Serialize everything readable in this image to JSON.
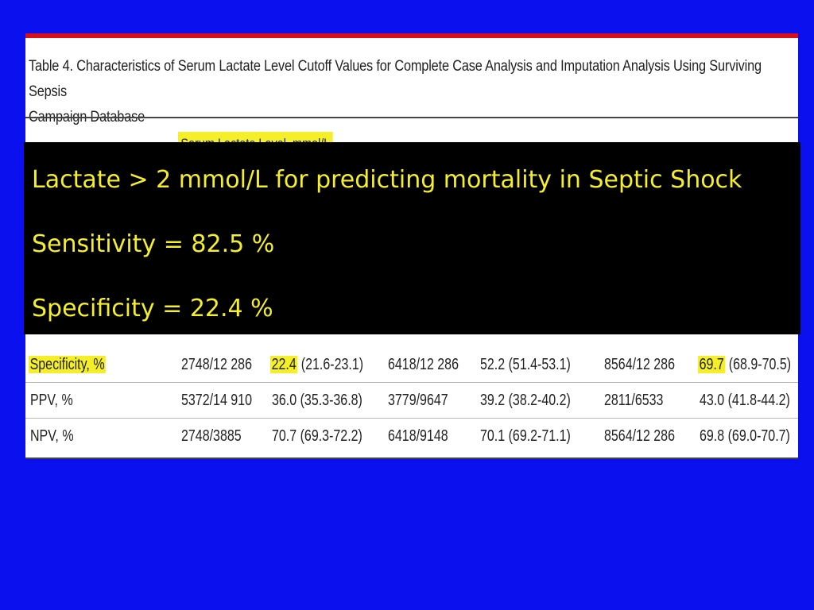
{
  "table": {
    "title_line1": "Table 4. Characteristics of Serum Lactate Level Cutoff Values for Complete Case Analysis and Imputation Analysis Using Surviving Sepsis",
    "title_line2": "Campaign Database",
    "serum_header": "Serum Lactate Level, mmol/L",
    "rows": [
      {
        "label": "Specificity, %",
        "label_highlighted": true,
        "c1": "2748/12 286",
        "c2": "22.4",
        "c2_ci": " (21.6-23.1)",
        "c2_highlighted": true,
        "c3": "6418/12 286",
        "c4": "52.2 (51.4-53.1)",
        "c5": "8564/12 286",
        "c6": "69.7",
        "c6_ci": " (68.9-70.5)",
        "c6_highlighted": true
      },
      {
        "label": "PPV, %",
        "c1": "5372/14 910",
        "c2": "36.0",
        "c2_ci": " (35.3-36.8)",
        "c3": "3779/9647",
        "c4": "39.2 (38.2-40.2)",
        "c5": "2811/6533",
        "c6": "43.0",
        "c6_ci": " (41.8-44.2)"
      },
      {
        "label": "NPV, %",
        "c1": "2748/3885",
        "c2": "70.7",
        "c2_ci": " (69.3-72.2)",
        "c3": "6418/9148",
        "c4": "70.1 (69.2-71.1)",
        "c5": "8564/12 286",
        "c6": "69.8",
        "c6_ci": " (69.0-70.7)"
      }
    ]
  },
  "overlay": {
    "line1": "Lactate > 2 mmol/L for predicting mortality in Septic Shock",
    "line2": "Sensitivity = 82.5 %",
    "line3": "Specificity = 22.4 %"
  },
  "colors": {
    "background": "#0a10ee",
    "highlight": "#f5ef2a",
    "accent_rule": "#d8101c",
    "overlay_bg": "#000000"
  }
}
